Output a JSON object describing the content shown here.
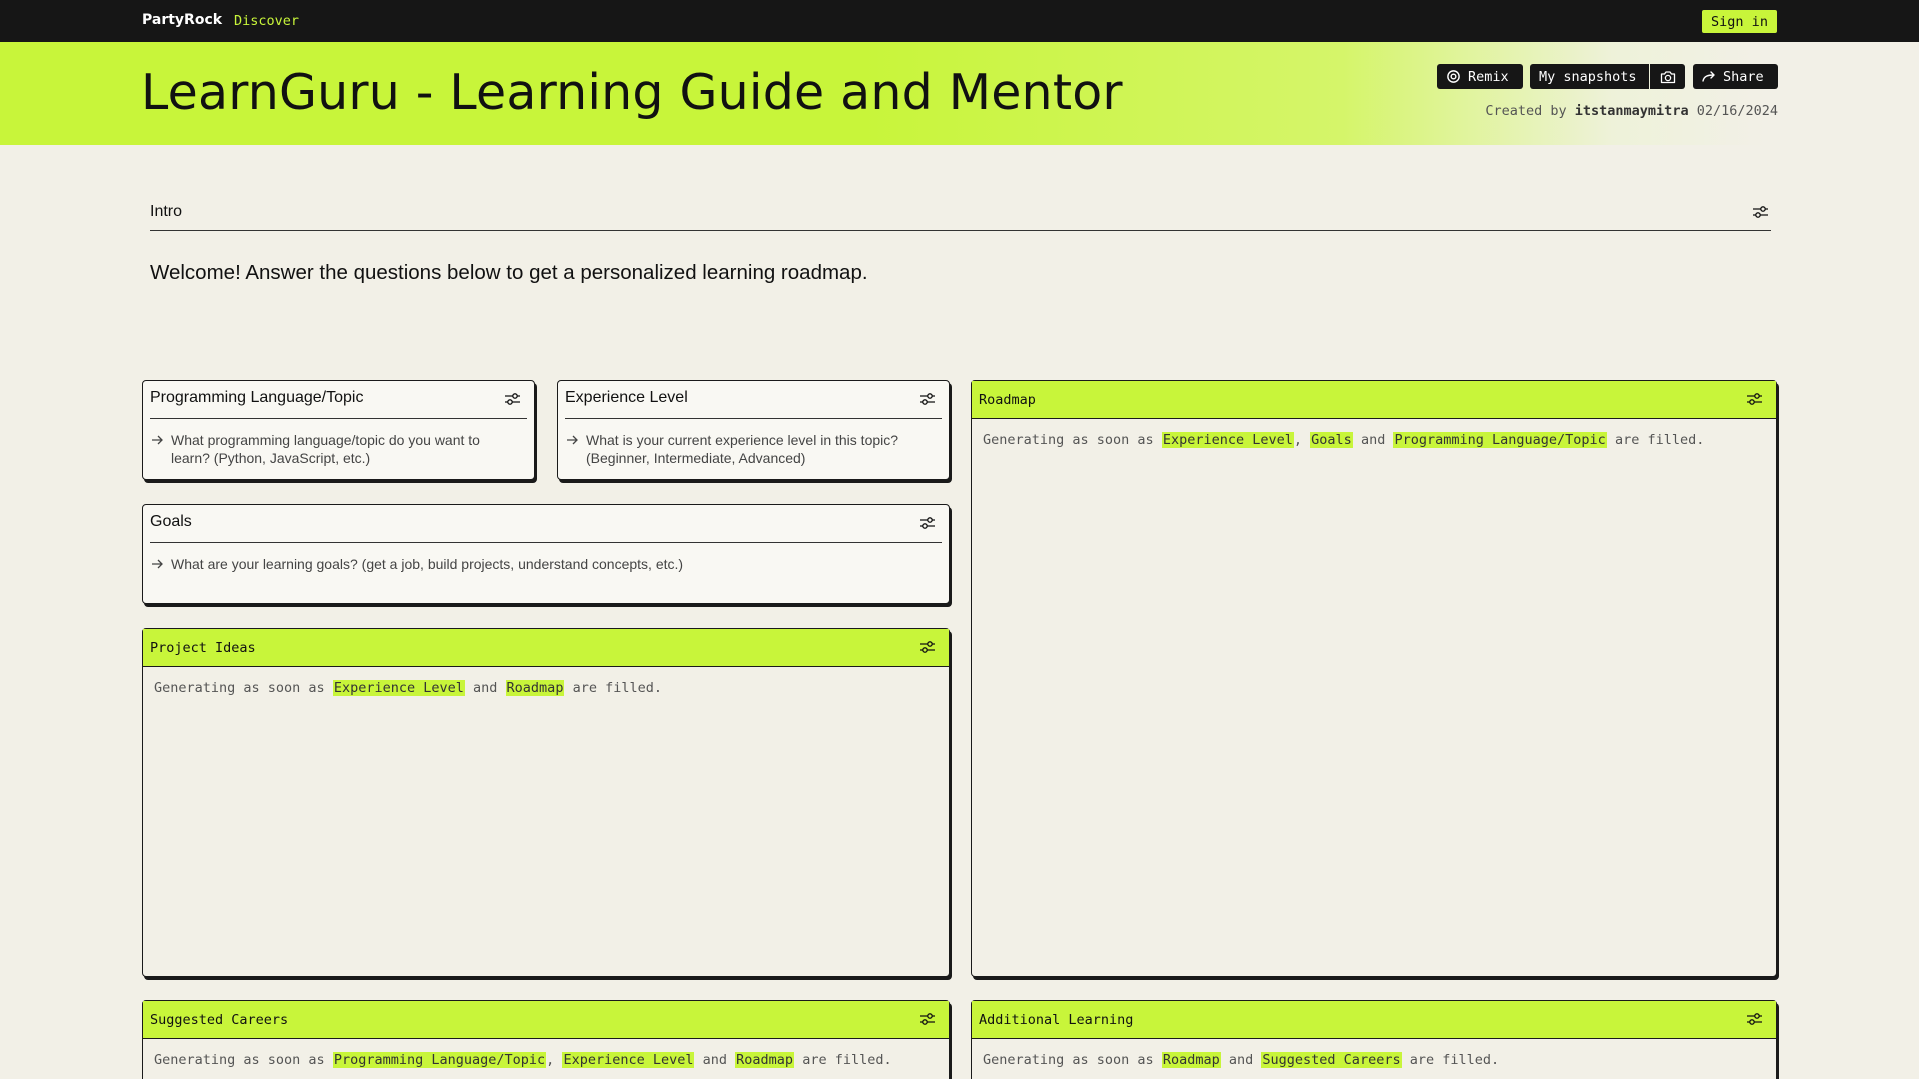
{
  "topbar": {
    "brand": "PartyRock",
    "discover": "Discover",
    "sign_in": "Sign in"
  },
  "header": {
    "title": "LearnGuru - Learning Guide and Mentor",
    "remix": "Remix",
    "my_snapshots": "My snapshots",
    "share": "Share",
    "created_prefix": "Created by",
    "author": "itstanmaymitra",
    "date": "02/16/2024"
  },
  "intro": {
    "label": "Intro",
    "text": "Welcome! Answer the questions below to get a personalized learning roadmap."
  },
  "inputs": {
    "language": {
      "title": "Programming Language/Topic",
      "prompt": "What programming language/topic do you want to learn? (Python, JavaScript, etc.)"
    },
    "experience": {
      "title": "Experience Level",
      "prompt": "What is your current experience level in this topic? (Beginner, Intermediate, Advanced)"
    },
    "goals": {
      "title": "Goals",
      "prompt": "What are your learning goals? (get a job, build projects, understand concepts, etc.)"
    }
  },
  "outputs": {
    "roadmap": {
      "title": "Roadmap",
      "prefix": "Generating as soon as",
      "dep1": "Experience Level",
      "sep1": ",",
      "dep2": "Goals",
      "and": "and",
      "dep3": "Programming Language/Topic",
      "suffix": "are filled."
    },
    "project_ideas": {
      "title": "Project Ideas",
      "prefix": "Generating as soon as",
      "dep1": "Experience Level",
      "and": "and",
      "dep2": "Roadmap",
      "suffix": "are filled."
    },
    "suggested_careers": {
      "title": "Suggested Careers",
      "prefix": "Generating as soon as",
      "dep1": "Programming Language/Topic",
      "sep1": ",",
      "dep2": "Experience Level",
      "and": "and",
      "dep3": "Roadmap",
      "suffix": "are filled."
    },
    "additional_learning": {
      "title": "Additional Learning",
      "prefix": "Generating as soon as",
      "dep1": "Roadmap",
      "and": "and",
      "dep2": "Suggested Careers",
      "suffix": "are filled."
    }
  },
  "colors": {
    "accent": "#c8f53a",
    "dark": "#161616",
    "background": "#f2f0e7"
  },
  "icons": [
    "settings-sliders-icon",
    "arrow-right-icon",
    "remix-icon",
    "camera-icon",
    "share-arrow-icon"
  ]
}
